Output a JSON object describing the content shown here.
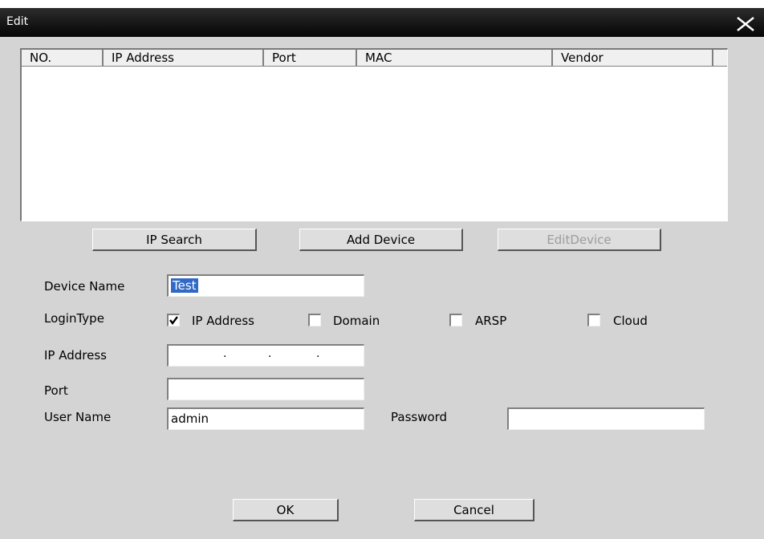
{
  "window": {
    "title": "Edit",
    "close_icon": "close-icon"
  },
  "device_list": {
    "columns": [
      "NO.",
      "IP Address",
      "Port",
      "MAC",
      "Vendor",
      ""
    ],
    "rows": []
  },
  "buttons": {
    "ip_search": "IP Search",
    "add_device": "Add Device",
    "edit_device": "EditDevice",
    "ok": "OK",
    "cancel": "Cancel"
  },
  "form": {
    "device_name_label": "Device Name",
    "device_name_value": "Test",
    "login_type_label": "LoginType",
    "login_types": [
      {
        "label": "IP Address",
        "checked": true
      },
      {
        "label": "Domain",
        "checked": false
      },
      {
        "label": "ARSP",
        "checked": false
      },
      {
        "label": "Cloud",
        "checked": false
      }
    ],
    "ip_address_label": "IP Address",
    "ip_address_separators": [
      ".",
      ".",
      "."
    ],
    "port_label": "Port",
    "port_value": "",
    "user_name_label": "User Name",
    "user_name_value": "admin",
    "password_label": "Password",
    "password_value": ""
  },
  "colors": {
    "dialog_bg": "#d4d4d4",
    "titlebar": "#050505",
    "selection": "#3169c6",
    "disabled_text": "#9c9c9c"
  }
}
